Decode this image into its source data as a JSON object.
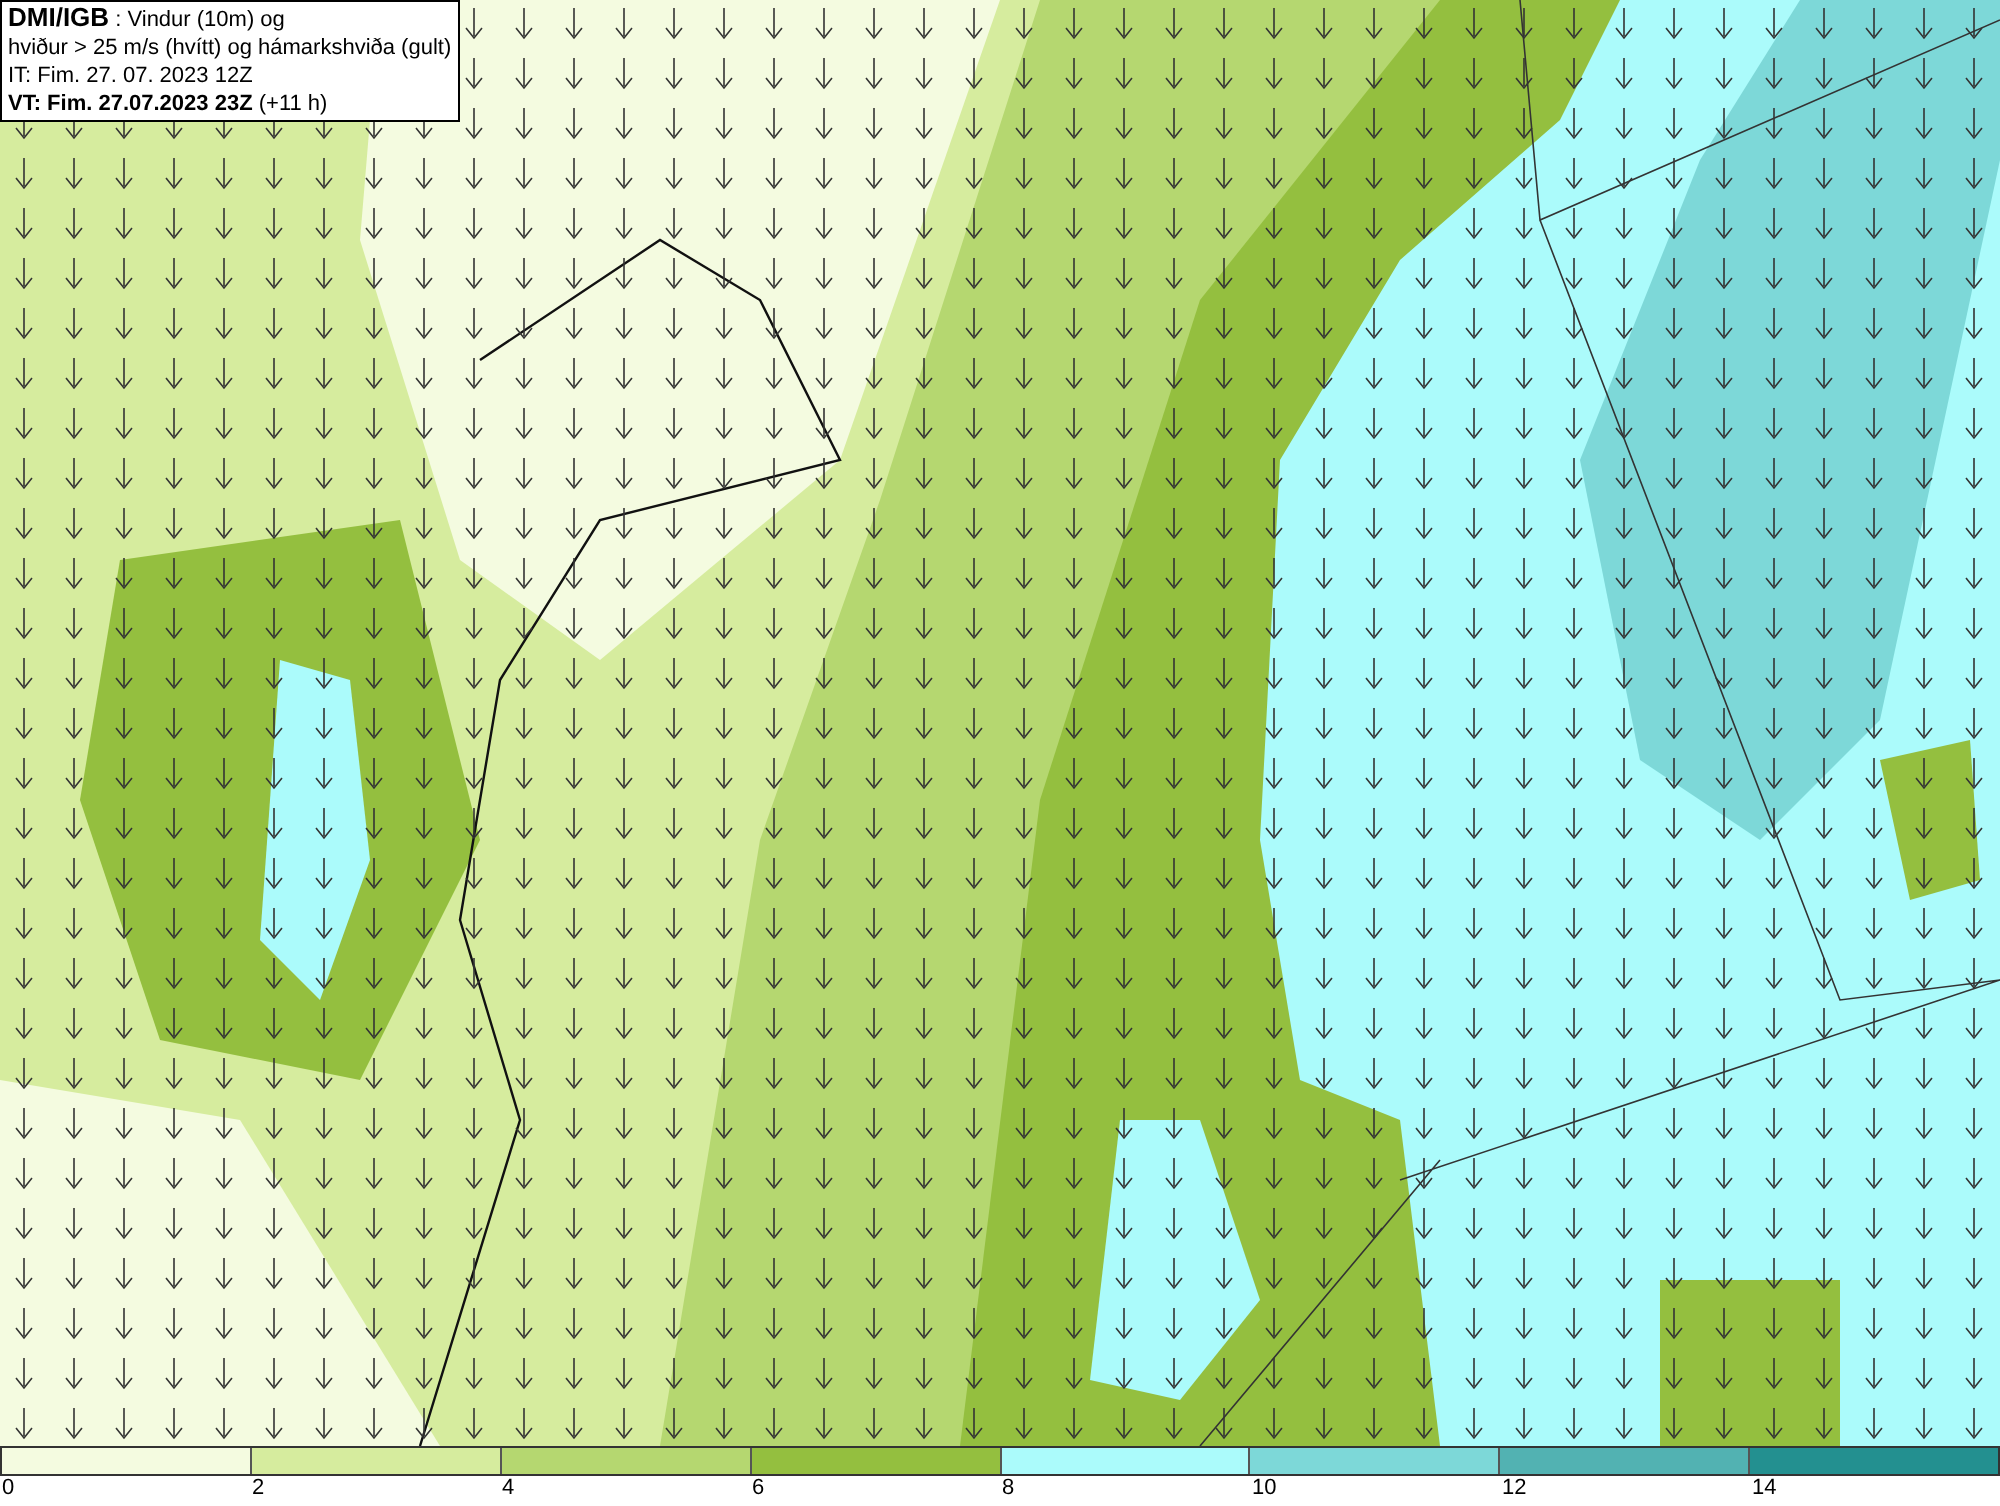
{
  "info_box": {
    "lines": [
      "**DMI/IGB** : Vindur (10m) og",
      "hviður > 25 m/s (hvítt) og hámarkshviða (gult)",
      "IT: Fim. 27. 07. 2023 12Z",
      "**VT: Fim. 27.07.2023 23Z** (+11 h)"
    ]
  },
  "colorbar": {
    "bins": [
      {
        "color": "#f4fbe0"
      },
      {
        "color": "#d6ec9e"
      },
      {
        "color": "#b5d770"
      },
      {
        "color": "#94bf3f"
      },
      {
        "color": "#abfbfb"
      },
      {
        "color": "#7dd8d8"
      },
      {
        "color": "#52b2b2"
      },
      {
        "color": "#239090"
      }
    ],
    "ticks": [
      "0",
      "2",
      "4",
      "6",
      "8",
      "10",
      "12",
      "14"
    ]
  }
}
